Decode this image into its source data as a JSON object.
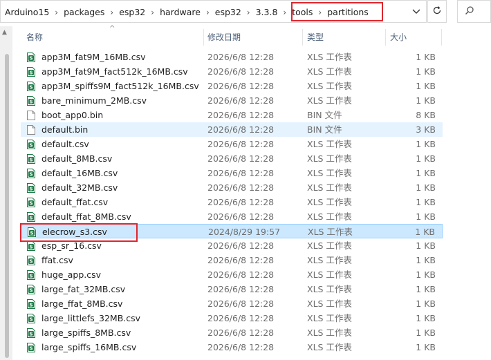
{
  "address_bar": {
    "crumbs": [
      "Arduino15",
      "packages",
      "esp32",
      "hardware",
      "esp32",
      "3.3.8",
      "tools",
      "partitions"
    ],
    "dropdown_icon": "chevron-down-icon",
    "refresh_icon": "refresh-icon",
    "search_icon": "search-icon"
  },
  "columns": {
    "name": "名称",
    "date": "修改日期",
    "type": "类型",
    "size": "大小"
  },
  "files": [
    {
      "name": "app3M_fat9M_16MB.csv",
      "date": "2026/6/8 12:28",
      "type": "XLS 工作表",
      "size": "1 KB",
      "icon": "csv"
    },
    {
      "name": "app3M_fat9M_fact512k_16MB.csv",
      "date": "2026/6/8 12:28",
      "type": "XLS 工作表",
      "size": "1 KB",
      "icon": "csv"
    },
    {
      "name": "app3M_spiffs9M_fact512k_16MB.csv",
      "date": "2026/6/8 12:28",
      "type": "XLS 工作表",
      "size": "1 KB",
      "icon": "csv"
    },
    {
      "name": "bare_minimum_2MB.csv",
      "date": "2026/6/8 12:28",
      "type": "XLS 工作表",
      "size": "1 KB",
      "icon": "csv"
    },
    {
      "name": "boot_app0.bin",
      "date": "2026/6/8 12:28",
      "type": "BIN 文件",
      "size": "8 KB",
      "icon": "bin"
    },
    {
      "name": "default.bin",
      "date": "2026/6/8 12:28",
      "type": "BIN 文件",
      "size": "3 KB",
      "icon": "bin"
    },
    {
      "name": "default.csv",
      "date": "2026/6/8 12:28",
      "type": "XLS 工作表",
      "size": "1 KB",
      "icon": "csv"
    },
    {
      "name": "default_8MB.csv",
      "date": "2026/6/8 12:28",
      "type": "XLS 工作表",
      "size": "1 KB",
      "icon": "csv"
    },
    {
      "name": "default_16MB.csv",
      "date": "2026/6/8 12:28",
      "type": "XLS 工作表",
      "size": "1 KB",
      "icon": "csv"
    },
    {
      "name": "default_32MB.csv",
      "date": "2026/6/8 12:28",
      "type": "XLS 工作表",
      "size": "1 KB",
      "icon": "csv"
    },
    {
      "name": "default_ffat.csv",
      "date": "2026/6/8 12:28",
      "type": "XLS 工作表",
      "size": "1 KB",
      "icon": "csv"
    },
    {
      "name": "default_ffat_8MB.csv",
      "date": "2026/6/8 12:28",
      "type": "XLS 工作表",
      "size": "1 KB",
      "icon": "csv"
    },
    {
      "name": "elecrow_s3.csv",
      "date": "2024/8/29 19:57",
      "type": "XLS 工作表",
      "size": "1 KB",
      "icon": "csv"
    },
    {
      "name": "esp_sr_16.csv",
      "date": "2026/6/8 12:28",
      "type": "XLS 工作表",
      "size": "1 KB",
      "icon": "csv"
    },
    {
      "name": "ffat.csv",
      "date": "2026/6/8 12:28",
      "type": "XLS 工作表",
      "size": "1 KB",
      "icon": "csv"
    },
    {
      "name": "huge_app.csv",
      "date": "2026/6/8 12:28",
      "type": "XLS 工作表",
      "size": "1 KB",
      "icon": "csv"
    },
    {
      "name": "large_fat_32MB.csv",
      "date": "2026/6/8 12:28",
      "type": "XLS 工作表",
      "size": "1 KB",
      "icon": "csv"
    },
    {
      "name": "large_ffat_8MB.csv",
      "date": "2026/6/8 12:28",
      "type": "XLS 工作表",
      "size": "1 KB",
      "icon": "csv"
    },
    {
      "name": "large_littlefs_32MB.csv",
      "date": "2026/6/8 12:28",
      "type": "XLS 工作表",
      "size": "1 KB",
      "icon": "csv"
    },
    {
      "name": "large_spiffs_8MB.csv",
      "date": "2026/6/8 12:28",
      "type": "XLS 工作表",
      "size": "1 KB",
      "icon": "csv"
    },
    {
      "name": "large_spiffs_16MB.csv",
      "date": "2026/6/8 12:28",
      "type": "XLS 工作表",
      "size": "1 KB",
      "icon": "csv"
    }
  ],
  "hover_index": 5,
  "selected_index": 12,
  "colors": {
    "highlight_box": "#e0262d",
    "selected_bg": "#cce8ff",
    "hover_bg": "#e5f3ff",
    "csv_icon": "#1d7a45"
  }
}
